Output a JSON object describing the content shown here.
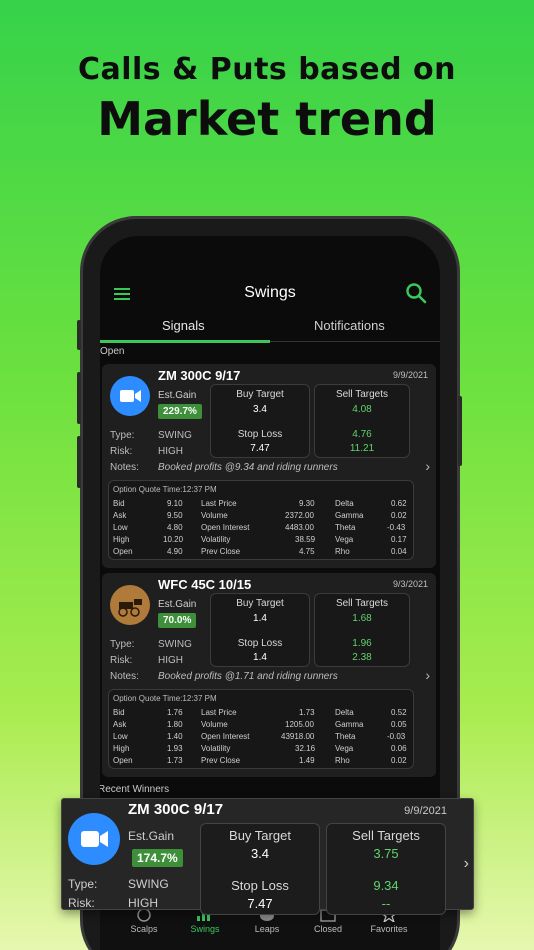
{
  "headline": {
    "line1": "Calls & Puts based on",
    "line2": "Market trend"
  },
  "app": {
    "title": "Swings",
    "tabs": [
      {
        "label": "Signals"
      },
      {
        "label": "Notifications"
      }
    ],
    "open_label": "Open",
    "recent_label": "Recent Winners"
  },
  "cards": [
    {
      "symbol": "ZM 300C 9/17",
      "date": "9/9/2021",
      "est_gain_label": "Est.Gain",
      "est_gain": "229.7%",
      "buy_target_label": "Buy Target",
      "buy_target": "3.4",
      "stop_loss_label": "Stop Loss",
      "stop_loss": "7.47",
      "sell_targets_label": "Sell Targets",
      "sell_targets": [
        "4.08",
        "4.76",
        "11.21"
      ],
      "type_label": "Type:",
      "type": "SWING",
      "risk_label": "Risk:",
      "risk": "HIGH",
      "notes_label": "Notes:",
      "notes": "Booked profits @9.34 and riding runners",
      "quote_time": "Option Quote Time:12:37 PM",
      "quote_rows": [
        [
          "Bid",
          "9.10",
          "Last Price",
          "9.30",
          "Delta",
          "0.62"
        ],
        [
          "Ask",
          "9.50",
          "Volume",
          "2372.00",
          "Gamma",
          "0.02"
        ],
        [
          "Low",
          "4.80",
          "Open Interest",
          "4483.00",
          "Theta",
          "-0.43"
        ],
        [
          "High",
          "10.20",
          "Volatility",
          "38.59",
          "Vega",
          "0.17"
        ],
        [
          "Open",
          "4.90",
          "Prev Close",
          "4.75",
          "Rho",
          "0.04"
        ]
      ]
    },
    {
      "symbol": "WFC 45C 10/15",
      "date": "9/3/2021",
      "est_gain_label": "Est.Gain",
      "est_gain": "70.0%",
      "buy_target_label": "Buy Target",
      "buy_target": "1.4",
      "stop_loss_label": "Stop Loss",
      "stop_loss": "1.4",
      "sell_targets_label": "Sell Targets",
      "sell_targets": [
        "1.68",
        "1.96",
        "2.38"
      ],
      "type_label": "Type:",
      "type": "SWING",
      "risk_label": "Risk:",
      "risk": "HIGH",
      "notes_label": "Notes:",
      "notes": "Booked profits @1.71 and riding runners",
      "quote_time": "Option Quote Time:12:37 PM",
      "quote_rows": [
        [
          "Bid",
          "1.76",
          "Last Price",
          "1.73",
          "Delta",
          "0.52"
        ],
        [
          "Ask",
          "1.80",
          "Volume",
          "1205.00",
          "Gamma",
          "0.05"
        ],
        [
          "Low",
          "1.40",
          "Open Interest",
          "43918.00",
          "Theta",
          "-0.03"
        ],
        [
          "High",
          "1.93",
          "Volatility",
          "32.16",
          "Vega",
          "0.06"
        ],
        [
          "Open",
          "1.73",
          "Prev Close",
          "1.49",
          "Rho",
          "0.02"
        ]
      ]
    }
  ],
  "overlay": {
    "symbol": "ZM 300C 9/17",
    "date": "9/9/2021",
    "est_gain_label": "Est.Gain",
    "est_gain": "174.7%",
    "buy_target_label": "Buy Target",
    "buy_target": "3.4",
    "stop_loss_label": "Stop Loss",
    "stop_loss": "7.47",
    "sell_targets_label": "Sell Targets",
    "sell_targets": [
      "3.75",
      "9.34",
      "--"
    ],
    "type_label": "Type:",
    "type": "SWING",
    "risk_label": "Risk:",
    "risk": "HIGH"
  },
  "nav": [
    {
      "label": "Scalps",
      "icon": "scalps-icon"
    },
    {
      "label": "Swings",
      "icon": "swings-icon",
      "active": true
    },
    {
      "label": "Leaps",
      "icon": "leaps-icon"
    },
    {
      "label": "Closed",
      "icon": "closed-icon"
    },
    {
      "label": "Favorites",
      "icon": "star-icon"
    }
  ],
  "colors": {
    "accent": "#39c95a",
    "card": "#1f1f1f",
    "badge": "#3d8f3a"
  }
}
